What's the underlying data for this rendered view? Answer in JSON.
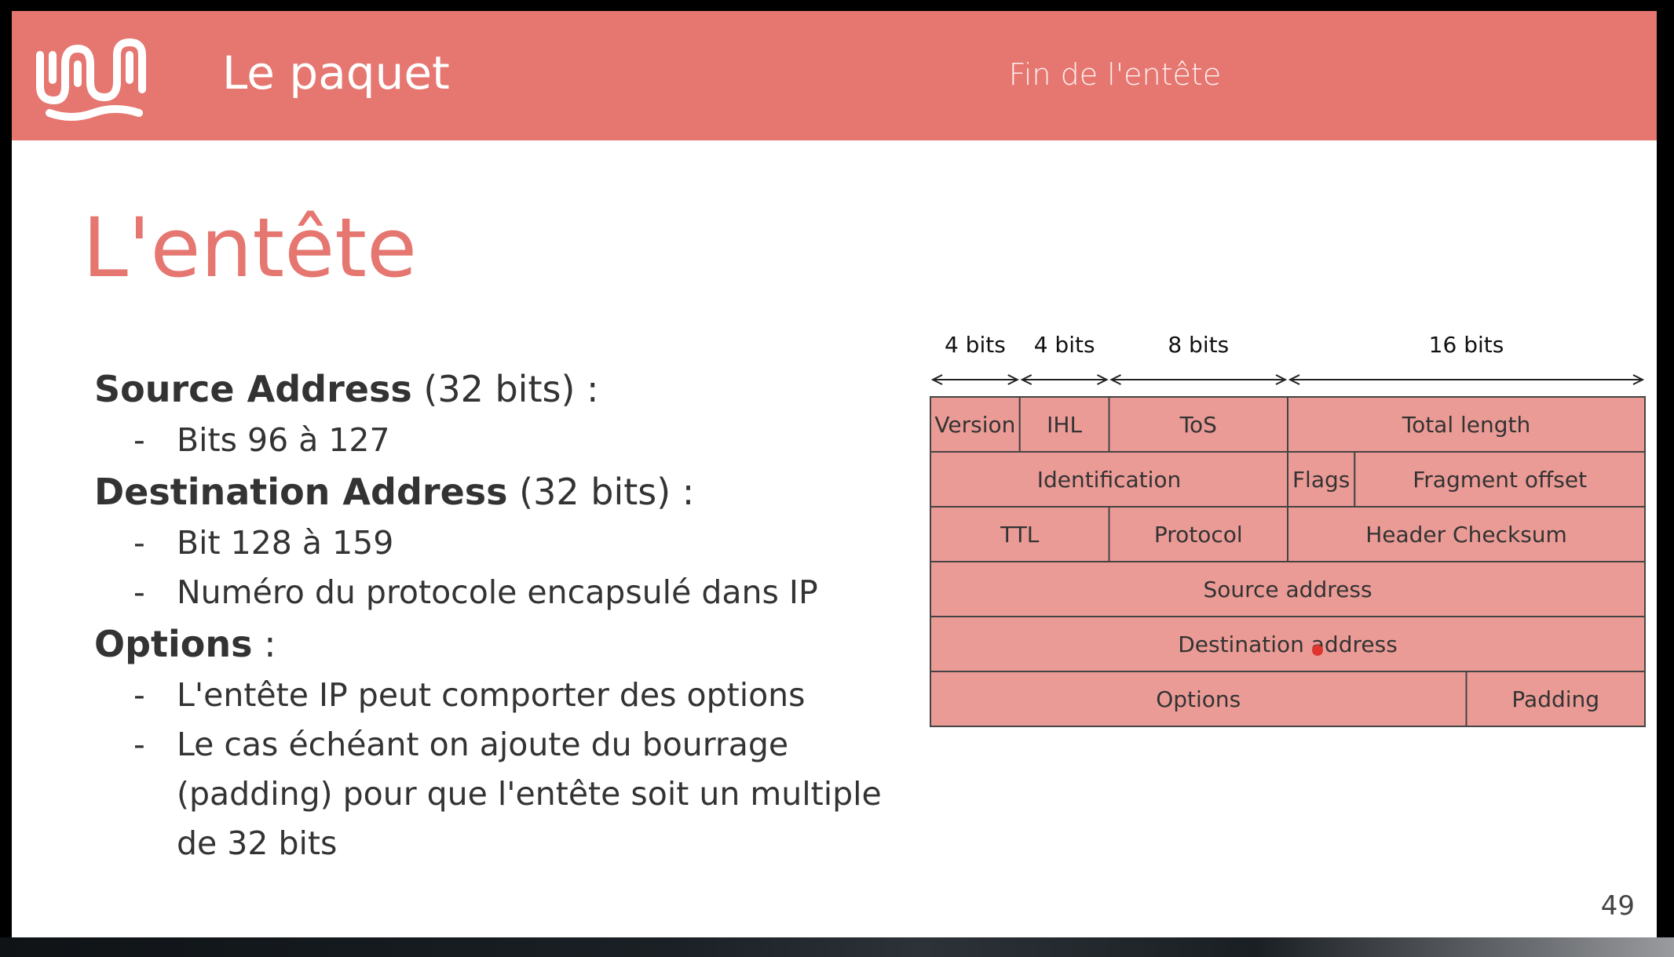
{
  "header": {
    "deck_title": "Le paquet",
    "section_title": "Fin de l'entête",
    "background": "#e57670"
  },
  "slide": {
    "title": "L'entête",
    "title_color": "#e57670",
    "page_number": "49"
  },
  "content": {
    "sections": [
      {
        "name": "Source Address",
        "suffix": " (32 bits) :",
        "items": [
          "Bits 96 à 127"
        ]
      },
      {
        "name": "Destination Address",
        "suffix": " (32 bits) :",
        "items": [
          "Bit 128 à 159",
          "Numéro du protocole encapsulé dans IP"
        ]
      },
      {
        "name": "Options",
        "suffix": " :",
        "items": [
          "L'entête IP peut comporter des options",
          "Le cas échéant on ajoute du bourrage",
          "(padding) pour que l'entête soit un multiple",
          "de 32 bits"
        ],
        "continuation_from": 2
      }
    ]
  },
  "diagram": {
    "field_fill": "#eb9b96",
    "border_color": "#444444",
    "widths": [
      {
        "label": "4 bits",
        "bits": 4
      },
      {
        "label": "4 bits",
        "bits": 4
      },
      {
        "label": "8 bits",
        "bits": 8
      },
      {
        "label": "16 bits",
        "bits": 16
      }
    ],
    "rows": [
      [
        {
          "label": "Version",
          "bits": 4
        },
        {
          "label": "IHL",
          "bits": 4
        },
        {
          "label": "ToS",
          "bits": 8
        },
        {
          "label": "Total length",
          "bits": 16
        }
      ],
      [
        {
          "label": "Identification",
          "bits": 16
        },
        {
          "label": "Flags",
          "bits": 3
        },
        {
          "label": "Fragment offset",
          "bits": 13
        }
      ],
      [
        {
          "label": "TTL",
          "bits": 8
        },
        {
          "label": "Protocol",
          "bits": 8
        },
        {
          "label": "Header Checksum",
          "bits": 16
        }
      ],
      [
        {
          "label": "Source address",
          "bits": 32
        }
      ],
      [
        {
          "label": "Destination address",
          "bits": 32
        }
      ],
      [
        {
          "label": "Options",
          "bits": 24
        },
        {
          "label": "Padding",
          "bits": 8
        }
      ]
    ],
    "pointer_color": "#e0342f"
  }
}
